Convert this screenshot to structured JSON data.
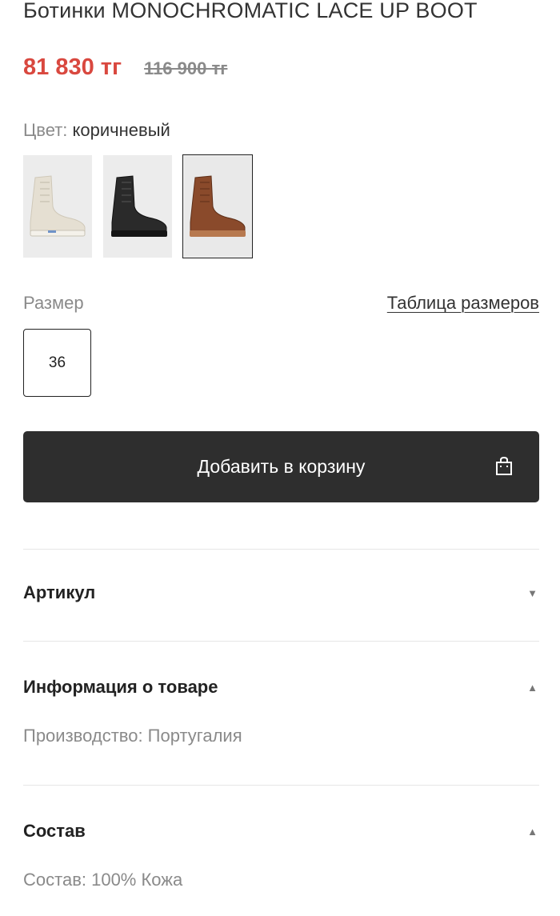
{
  "product": {
    "title": "Ботинки MONOCHROMATIC LACE UP BOOT",
    "price_current": "81 830 тг",
    "price_old": "116 900 тг"
  },
  "color": {
    "label": "Цвет:",
    "value": "коричневый",
    "swatches": [
      {
        "name": "beige",
        "selected": false
      },
      {
        "name": "black",
        "selected": false
      },
      {
        "name": "brown",
        "selected": true
      }
    ]
  },
  "size": {
    "label": "Размер",
    "table_link": "Таблица размеров",
    "options": [
      "36"
    ]
  },
  "cart": {
    "button_label": "Добавить в корзину",
    "icon": "shopping-bag-icon"
  },
  "accordion": {
    "article": {
      "title": "Артикул",
      "state": "collapsed"
    },
    "info": {
      "title": "Информация о товаре",
      "state": "expanded",
      "body": "Производство: Португалия"
    },
    "composition": {
      "title": "Состав",
      "state": "expanded",
      "body": "Состав: 100% Кожа"
    }
  },
  "colors": {
    "sale_price": "#d9483f",
    "button_bg": "#2e2e2e"
  }
}
